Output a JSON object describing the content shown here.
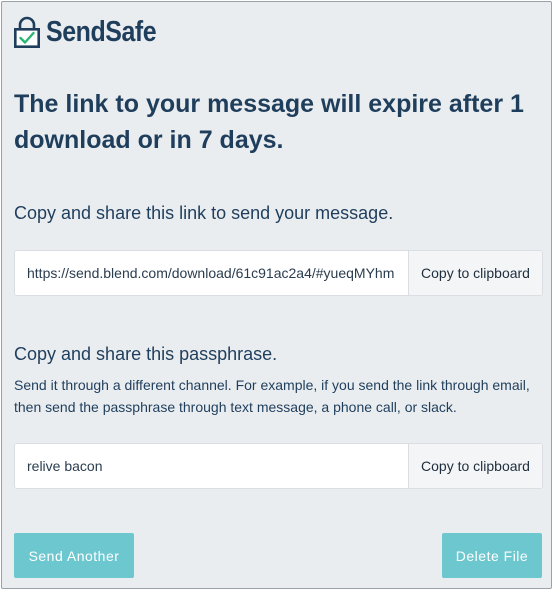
{
  "brand": {
    "name": "SendSafe",
    "color": "#1f3e5c",
    "check_color": "#2bb673"
  },
  "title": "The link to your message will expire after 1 download or in 7 days.",
  "link_section": {
    "heading": "Copy and share this link to send your message.",
    "url_value": "https://send.blend.com/download/61c91ac2a4/#yueqMYhm",
    "copy_button_label": "Copy to clipboard"
  },
  "passphrase_section": {
    "heading": "Copy and share this passphrase.",
    "description": "Send it through a different channel. For example, if you send the link through email, then send the passphrase through text message, a phone call, or slack.",
    "passphrase_value": "relive bacon",
    "copy_button_label": "Copy to clipboard"
  },
  "actions": {
    "send_another_label": "Send Another",
    "delete_file_label": "Delete File",
    "button_color": "#6cc7cf"
  }
}
